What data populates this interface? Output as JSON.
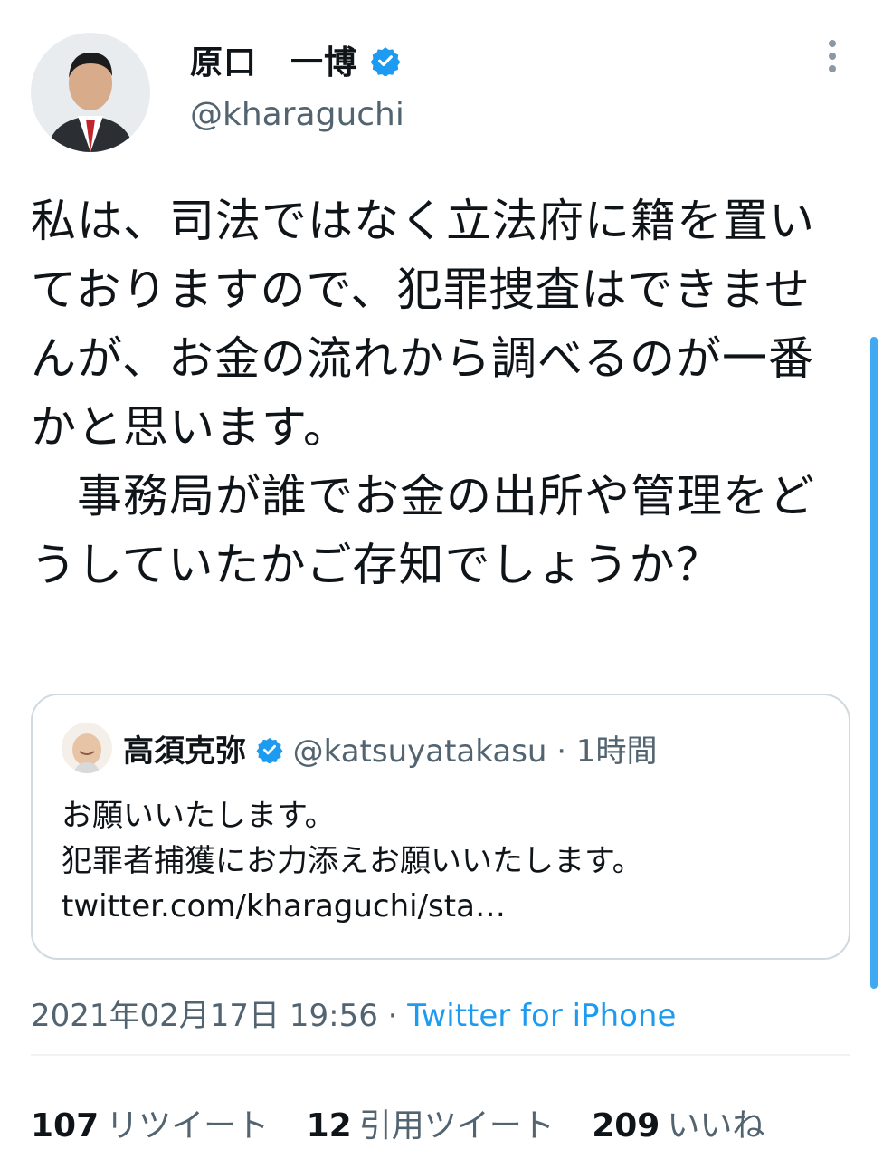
{
  "author": {
    "display_name": "原口　一博",
    "handle": "@kharaguchi",
    "verified": true
  },
  "tweet": {
    "text": "私は、司法ではなく立法府に籍を置いておりますので、犯罪捜査はできませんが、お金の流れから調べるのが一番かと思います。\n　事務局が誰でお金の出所や管理をどうしていたかご存知でしょうか？"
  },
  "quote": {
    "display_name": "高須克弥",
    "handle": "@katsuyatakasu",
    "separator": "·",
    "time": "1時間",
    "line1": "お願いいたします。",
    "line2": "犯罪者捕獲にお力添えお願いいたします。",
    "link": "twitter.com/kharaguchi/sta…"
  },
  "meta": {
    "timestamp": "2021年02月17日 19:56",
    "separator": "·",
    "source": "Twitter for iPhone"
  },
  "stats": {
    "retweets_count": "107",
    "retweets_label": "リツイート",
    "quotes_count": "12",
    "quotes_label": "引用ツイート",
    "likes_count": "209",
    "likes_label": "いいね"
  },
  "colors": {
    "accent": "#1d9bf0",
    "secondary_text": "#536471",
    "border": "#cfd9de"
  },
  "icons": {
    "verified": "verified-badge-icon",
    "more": "more-vertical-icon"
  }
}
